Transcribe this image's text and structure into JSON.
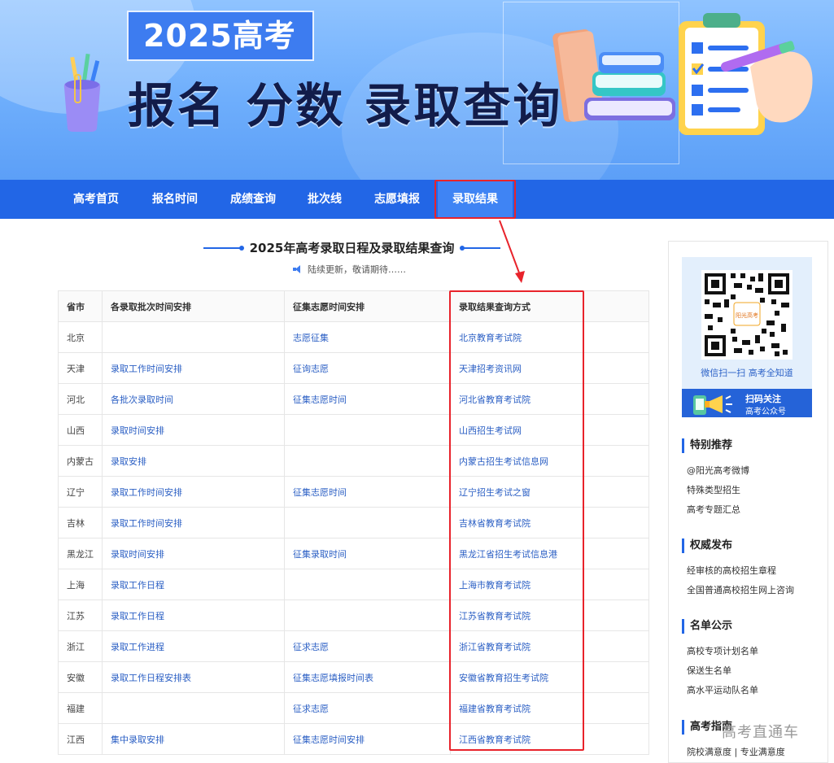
{
  "banner": {
    "year_badge": "2025高考",
    "headline": "报名 分数 录取查询"
  },
  "nav": {
    "items": [
      "高考首页",
      "报名时间",
      "成绩查询",
      "批次线",
      "志愿填报",
      "录取结果"
    ],
    "active_index": 5
  },
  "main": {
    "section_title": "2025年高考录取日程及录取结果查询",
    "notice": "陆续更新，敬请期待……",
    "table": {
      "headers": [
        "省市",
        "各录取批次时间安排",
        "征集志愿时间安排",
        "录取结果查询方式"
      ],
      "rows": [
        [
          "北京",
          "",
          "志愿征集",
          "北京教育考试院"
        ],
        [
          "天津",
          "录取工作时间安排",
          "征询志愿",
          "天津招考资讯网"
        ],
        [
          "河北",
          "各批次录取时间",
          "征集志愿时间",
          "河北省教育考试院"
        ],
        [
          "山西",
          "录取时间安排",
          "",
          "山西招生考试网"
        ],
        [
          "内蒙古",
          "录取安排",
          "",
          "内蒙古招生考试信息网"
        ],
        [
          "辽宁",
          "录取工作时间安排",
          "征集志愿时间",
          "辽宁招生考试之窗"
        ],
        [
          "吉林",
          "录取工作时间安排",
          "",
          "吉林省教育考试院"
        ],
        [
          "黑龙江",
          "录取时间安排",
          "征集录取时间",
          "黑龙江省招生考试信息港"
        ],
        [
          "上海",
          "录取工作日程",
          "",
          "上海市教育考试院"
        ],
        [
          "江苏",
          "录取工作日程",
          "",
          "江苏省教育考试院"
        ],
        [
          "浙江",
          "录取工作进程",
          "征求志愿",
          "浙江省教育考试院"
        ],
        [
          "安徽",
          "录取工作日程安排表",
          "征集志愿填报时间表",
          "安徽省教育招生考试院"
        ],
        [
          "福建",
          "",
          "征求志愿",
          "福建省教育考试院"
        ],
        [
          "江西",
          "集中录取安排",
          "征集志愿时间安排",
          "江西省教育考试院"
        ]
      ]
    }
  },
  "sidebar": {
    "qr_caption": "微信扫一扫  高考全知道",
    "qr_logo": "阳光高考",
    "follow_line1": "扫码关注",
    "follow_line2": "高考公众号",
    "sections": [
      {
        "title": "特别推荐",
        "links": [
          "@阳光高考微博",
          "特殊类型招生",
          "高考专题汇总"
        ]
      },
      {
        "title": "权威发布",
        "links": [
          "经审核的高校招生章程",
          "全国普通高校招生网上咨询"
        ]
      },
      {
        "title": "名单公示",
        "links": [
          "高校专项计划名单",
          "保送生名单",
          "高水平运动队名单"
        ]
      },
      {
        "title": "高考指南",
        "links": [
          "院校满意度 | 专业满意度"
        ]
      }
    ]
  },
  "watermark": "高考直通车",
  "colors": {
    "nav_bg": "#2266e6",
    "nav_active": "#3f84f4",
    "highlight_red": "#e8232b",
    "link_blue": "#2b5fc4",
    "banner_title": "#121c4a"
  }
}
